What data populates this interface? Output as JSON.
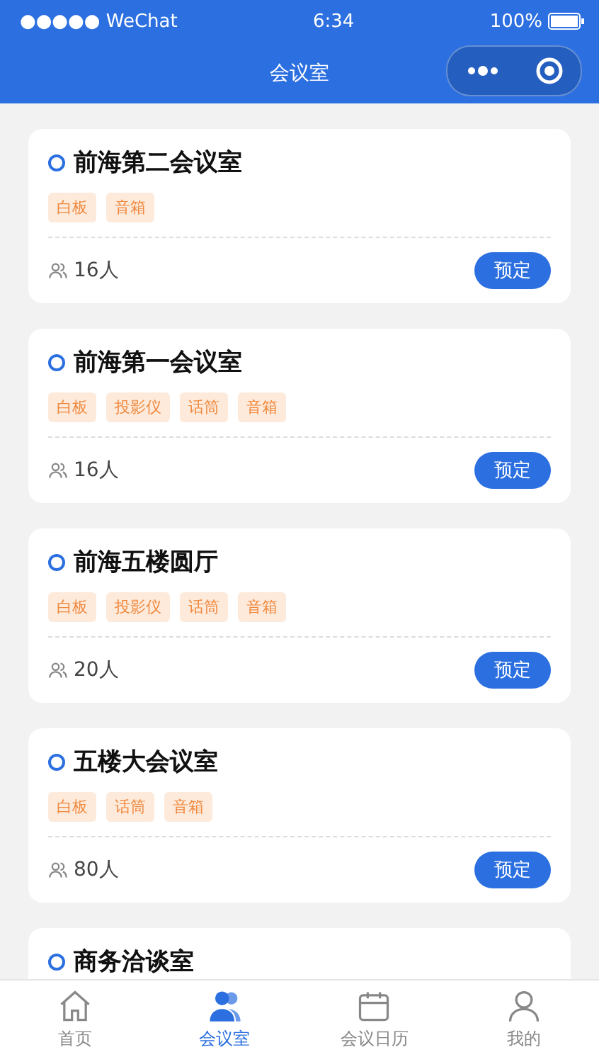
{
  "status_bar": {
    "carrier": "●●●●● WeChat",
    "time": "6:34",
    "battery": "100%"
  },
  "nav_bar": {
    "title": "会议室"
  },
  "rooms": [
    {
      "name": "前海第二会议室",
      "tags": [
        "白板",
        "音箱"
      ],
      "capacity": "16人",
      "action": "预定"
    },
    {
      "name": "前海第一会议室",
      "tags": [
        "白板",
        "投影仪",
        "话筒",
        "音箱"
      ],
      "capacity": "16人",
      "action": "预定"
    },
    {
      "name": "前海五楼圆厅",
      "tags": [
        "白板",
        "投影仪",
        "话筒",
        "音箱"
      ],
      "capacity": "20人",
      "action": "预定"
    },
    {
      "name": "五楼大会议室",
      "tags": [
        "白板",
        "话筒",
        "音箱"
      ],
      "capacity": "80人",
      "action": "预定"
    },
    {
      "name": "商务洽谈室"
    }
  ],
  "tab_bar": [
    {
      "label": "首页",
      "kind": "home",
      "selected": false
    },
    {
      "label": "会议室",
      "kind": "rooms",
      "selected": true
    },
    {
      "label": "会议日历",
      "kind": "calendar",
      "selected": false
    },
    {
      "label": "我的",
      "kind": "profile",
      "selected": false
    }
  ]
}
